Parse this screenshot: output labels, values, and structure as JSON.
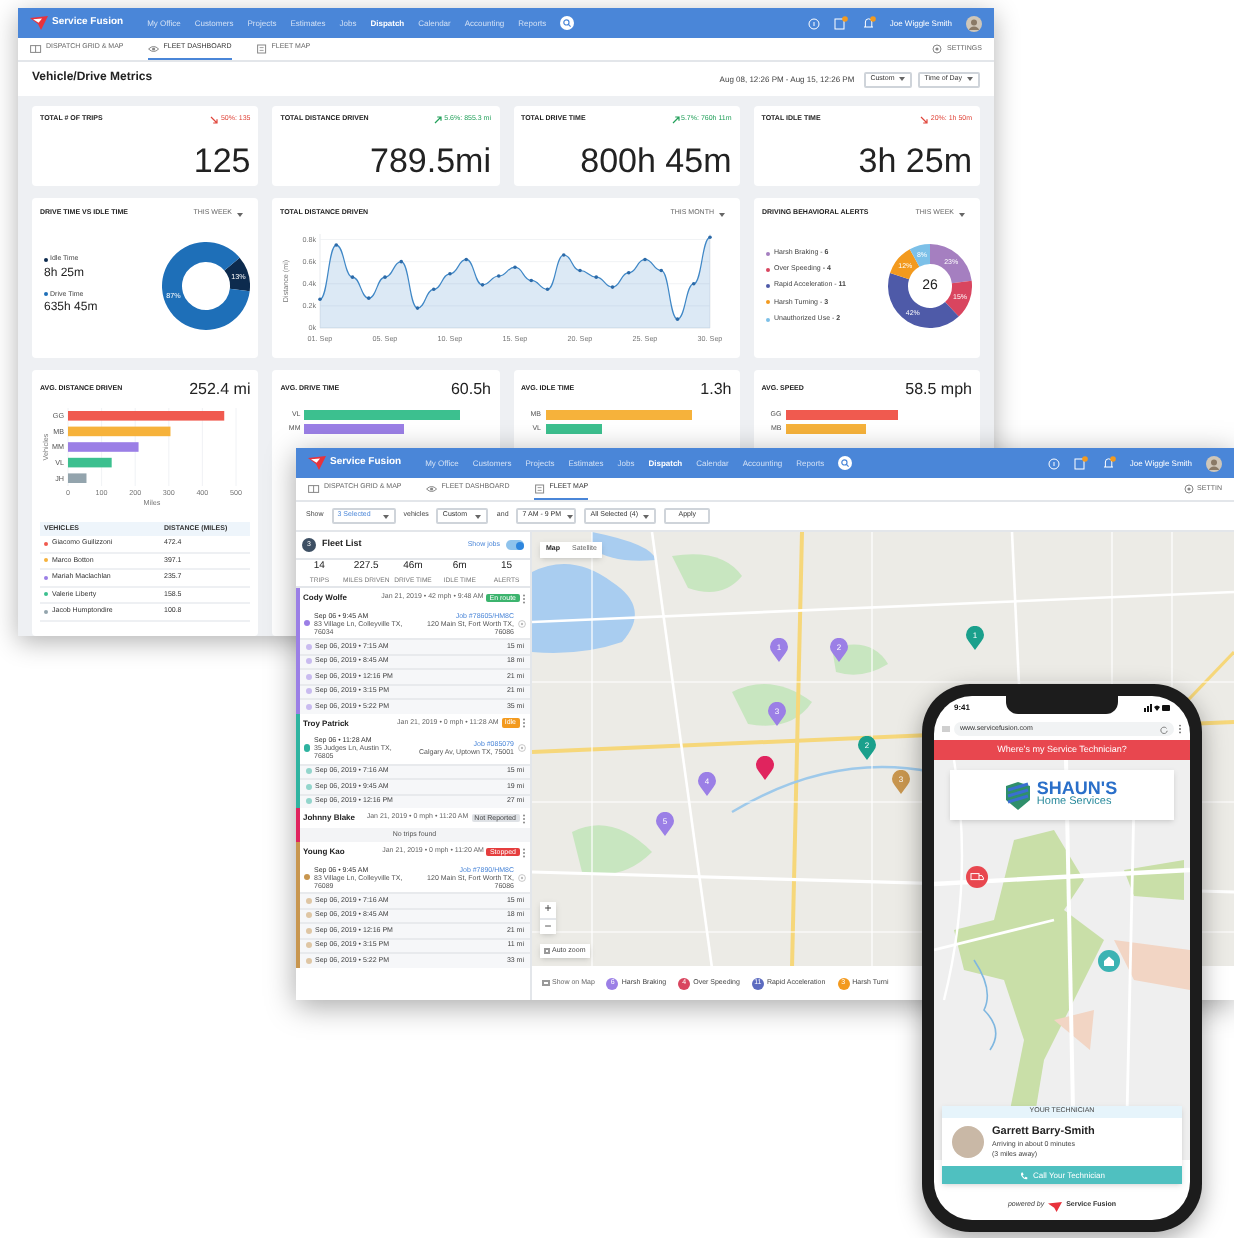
{
  "dashboard": {
    "nav": {
      "brand": "Service Fusion",
      "items": [
        {
          "label": "My Office",
          "selected": false
        },
        {
          "label": "Customers",
          "selected": false
        },
        {
          "label": "Projects",
          "selected": false
        },
        {
          "label": "Estimates",
          "selected": false
        },
        {
          "label": "Jobs",
          "selected": false
        },
        {
          "label": "Dispatch",
          "selected": true
        },
        {
          "label": "Calendar",
          "selected": false
        },
        {
          "label": "Accounting",
          "selected": false
        },
        {
          "label": "Reports",
          "selected": false
        }
      ],
      "user": "Joe Wiggle Smith"
    },
    "subnav": {
      "tabs": [
        {
          "label": "DISPATCH GRID & MAP",
          "selected": false
        },
        {
          "label": "FLEET DASHBOARD",
          "selected": true
        },
        {
          "label": "FLEET MAP",
          "selected": false
        }
      ],
      "settings": "SETTINGS"
    },
    "title": "Vehicle/Drive Metrics",
    "date_range": "Aug 08, 12:26 PM - Aug 15, 12:26 PM",
    "filters": [
      "Custom",
      "Time of Day"
    ],
    "stats": [
      {
        "label": "TOTAL # OF TRIPS",
        "change": "50%: 135",
        "increase": false,
        "value": "125"
      },
      {
        "label": "TOTAL DISTANCE DRIVEN",
        "change": "5.6%: 855.3 mi",
        "increase": true,
        "value": "789.5mi"
      },
      {
        "label": "TOTAL DRIVE TIME",
        "change": "5.7%: 760h 11m",
        "increase": true,
        "value": "800h 45m"
      },
      {
        "label": "TOTAL IDLE TIME",
        "change": "20%: 1h 50m",
        "increase": false,
        "value": "3h 25m"
      }
    ],
    "drive_vs_idle": {
      "title": "DRIVE TIME VS IDLE TIME",
      "period": "THIS WEEK",
      "legend": [
        {
          "value": "8h 25m",
          "color": "#0d2b4e"
        },
        {
          "value": "635h 45m",
          "color": "#1e6fb8"
        }
      ],
      "chart_data": {
        "type": "donut",
        "categories": [
          "Idle Time",
          "Drive Time"
        ],
        "values": [
          13,
          87
        ],
        "value_labels": [
          "13%",
          "87%"
        ]
      }
    },
    "distance": {
      "title": "TOTAL DISTANCE DRIVEN",
      "period": "THIS MONTH",
      "chart_data": {
        "type": "area",
        "ylabel": "Distance (mi)",
        "grid": true,
        "ylim": [
          0,
          0.85
        ],
        "categories": [
          "01. Sep",
          null,
          null,
          null,
          "05. Sep",
          null,
          null,
          null,
          "10. Sep",
          null,
          null,
          null,
          "15. Sep",
          null,
          null,
          null,
          "20. Sep",
          null,
          null,
          null,
          "25. Sep",
          null,
          null,
          null,
          "30. Sep"
        ],
        "yticks": [
          {
            "value": 0,
            "label": "0k"
          },
          {
            "value": 0.2,
            "label": "0.2k"
          },
          {
            "value": 0.4,
            "label": "0.4k"
          },
          {
            "value": 0.6,
            "label": "0.6k"
          },
          {
            "value": 0.8,
            "label": "0.8k"
          }
        ],
        "series": [
          {
            "color": "#3f87c6",
            "values": [
              0.26,
              0.75,
              0.46,
              0.27,
              0.46,
              0.6,
              0.18,
              0.35,
              0.49,
              0.62,
              0.39,
              0.47,
              0.55,
              0.43,
              0.35,
              0.66,
              0.52,
              0.46,
              0.37,
              0.5,
              0.62,
              0.52,
              0.08,
              0.4,
              0.82
            ]
          }
        ]
      }
    },
    "alerts": {
      "title": "DRIVING BEHAVIORAL ALERTS",
      "period": "THIS WEEK",
      "total": "26",
      "items": [
        {
          "text": "Harsh Braking - **6**",
          "color": "#a57fc0"
        },
        {
          "text": "Over Speeding - **4**",
          "color": "#d9455f"
        },
        {
          "text": "Rapid Acceleration - **11**",
          "color": "#4e5aa8"
        },
        {
          "text": "Harsh Turning - **3**",
          "color": "#f39a1e"
        },
        {
          "text": "Unauthorized Use - **2**",
          "color": "#7cc0e8"
        }
      ],
      "chart_data": {
        "type": "donut",
        "values": [
          23,
          15,
          42,
          12,
          8
        ],
        "value_labels": [
          "23%",
          "15%",
          "42%",
          "12%",
          "8%"
        ]
      }
    },
    "averages": [
      {
        "title": "AVG. DISTANCE DRIVEN",
        "value": "252.4 mi",
        "chart_data": {
          "type": "bar",
          "orientation": "horizontal",
          "grid": true,
          "xlabel": "Miles",
          "ylabel": "Vehicles",
          "categories": [
            "GG",
            "MB",
            "MM",
            "VL",
            "JH"
          ],
          "values": [
            465,
            305,
            210,
            130,
            55
          ],
          "xlim": [
            0,
            500
          ],
          "xticks": [
            0,
            100,
            200,
            300,
            400,
            500
          ]
        },
        "table": {
          "columns": [
            "VEHICLES",
            "DISTANCE (MILES)"
          ],
          "rows": [
            {
              "name": "Giacomo Guilizzoni",
              "value": "472.4",
              "color": "#f05a4f"
            },
            {
              "name": "Marco Botton",
              "value": "397.1",
              "color": "#f6b23b"
            },
            {
              "name": "Mariah Maclachlan",
              "value": "235.7",
              "color": "#9b7fe6"
            },
            {
              "name": "Valerie Liberty",
              "value": "158.5",
              "color": "#3cc08f"
            },
            {
              "name": "Jacob Humptondire",
              "value": "100.8",
              "color": "#93a4ad"
            }
          ]
        }
      },
      {
        "title": "AVG. DRIVE TIME",
        "value": "60.5h",
        "bar_labels": [
          "VL",
          "MM"
        ]
      },
      {
        "title": "AVG. IDLE TIME",
        "value": "1.3h",
        "bar_labels": [
          "MB",
          "VL"
        ]
      },
      {
        "title": "AVG. SPEED",
        "value": "58.5 mph",
        "bar_labels": [
          "GG",
          "MB"
        ]
      }
    ]
  },
  "fleet_map": {
    "nav": {
      "brand": "Service Fusion",
      "items": [
        {
          "label": "My Office",
          "selected": false
        },
        {
          "label": "Customers",
          "selected": false
        },
        {
          "label": "Projects",
          "selected": false
        },
        {
          "label": "Estimates",
          "selected": false
        },
        {
          "label": "Jobs",
          "selected": false
        },
        {
          "label": "Dispatch",
          "selected": true
        },
        {
          "label": "Calendar",
          "selected": false
        },
        {
          "label": "Accounting",
          "selected": false
        },
        {
          "label": "Reports",
          "selected": false
        }
      ],
      "user": "Joe Wiggle Smith"
    },
    "subnav": {
      "tabs": [
        {
          "label": "DISPATCH GRID & MAP",
          "selected": false
        },
        {
          "label": "FLEET DASHBOARD",
          "selected": false
        },
        {
          "label": "FLEET MAP",
          "selected": true
        }
      ],
      "settings": "SETTIN"
    },
    "filter_bar": {
      "show_label": "Show",
      "vehicles_select": "3 Selected",
      "vehicles_label": "vehicles",
      "range_select": "Custom",
      "and_label": "and",
      "time_select": "7 AM - 9 PM",
      "status_select": "All Selected (4)",
      "apply": "Apply"
    },
    "fleet_list": {
      "count": "3",
      "title": "Fleet List",
      "show_jobs": "Show jobs",
      "show_jobs_on": true,
      "stats": [
        {
          "value": "14",
          "label": "TRIPS"
        },
        {
          "value": "227.5",
          "label": "MILES DRIVEN"
        },
        {
          "value": "46m",
          "label": "DRIVE TIME"
        },
        {
          "value": "6m",
          "label": "IDLE TIME"
        },
        {
          "value": "15",
          "label": "ALERTS"
        }
      ],
      "drivers": [
        {
          "name": "Cody Wolfe",
          "info": "Jan 21, 2019 • 42 mph • 9:48 AM",
          "status": "En route",
          "kind": "en_route",
          "color": "#9b7fe6",
          "current": {
            "time": "Sep 06 • 9:45 AM",
            "address": "83 Village Ln, Colleyville TX, 76034",
            "job": "Job #78605/HM8C",
            "job_address": "120 Main St, Fort Worth TX, 76086"
          },
          "trips": [
            {
              "time": "Sep 06, 2019 • 7:15 AM",
              "distance": "15 mi"
            },
            {
              "time": "Sep 06, 2019 • 8:45 AM",
              "distance": "18 mi"
            },
            {
              "time": "Sep 06, 2019 • 12:16 PM",
              "distance": "21 mi"
            },
            {
              "time": "Sep 06, 2019 • 3:15 PM",
              "distance": "21 mi"
            },
            {
              "time": "Sep 06, 2019 • 5:22 PM",
              "distance": "35 mi"
            }
          ]
        },
        {
          "name": "Troy Patrick",
          "info": "Jan 21, 2019 • 0 mph • 11:28 AM",
          "status": "Idle",
          "kind": "idle",
          "color": "#2fb3a0",
          "current": {
            "time": "Sep 06 • 11:28 AM",
            "address": "35 Judges Ln, Austin TX, 76805",
            "job": "Job #085079",
            "job_address": "Calgary Av, Uptown TX, 75001"
          },
          "trips": [
            {
              "time": "Sep 06, 2019 • 7:16 AM",
              "distance": "15 mi"
            },
            {
              "time": "Sep 06, 2019 • 9:45 AM",
              "distance": "19 mi"
            },
            {
              "time": "Sep 06, 2019 • 12:16 PM",
              "distance": "27 mi"
            }
          ]
        },
        {
          "name": "Johnny Blake",
          "info": "Jan 21, 2019 • 0 mph • 11:20 AM",
          "status": "Not Reported",
          "kind": "not_reported",
          "color": "#e0245e",
          "no_trips": "No trips found"
        },
        {
          "name": "Young Kao",
          "info": "Jan 21, 2019 • 0 mph • 11:20 AM",
          "status": "Stopped",
          "kind": "stopped",
          "color": "#c8964f",
          "current": {
            "time": "Sep 06 • 9:45 AM",
            "address": "83 Village Ln, Colleyville TX, 76089",
            "job": "Job #7890/HM8C",
            "job_address": "120 Main St, Fort Worth TX, 76086"
          },
          "trips": [
            {
              "time": "Sep 06, 2019 • 7:16 AM",
              "distance": "15 mi"
            },
            {
              "time": "Sep 06, 2019 • 8:45 AM",
              "distance": "18 mi"
            },
            {
              "time": "Sep 06, 2019 • 12:16 PM",
              "distance": "21 mi"
            },
            {
              "time": "Sep 06, 2019 • 3:15 PM",
              "distance": "11 mi"
            },
            {
              "time": "Sep 06, 2019 • 5:22 PM",
              "distance": "33 mi"
            }
          ]
        }
      ]
    },
    "map": {
      "tabs": [
        {
          "label": "Map",
          "selected": true
        },
        {
          "label": "Satellite",
          "selected": false
        }
      ],
      "zoom_in": "+",
      "zoom_out": "−",
      "auto_zoom": "Auto zoom",
      "auto_zoom_checked": false,
      "pins": [
        {
          "label": "1",
          "color": "#1aa08c"
        },
        {
          "label": "1",
          "color": "#9b7fe6"
        },
        {
          "label": "2",
          "color": "#9b7fe6"
        },
        {
          "label": "3",
          "color": "#9b7fe6"
        },
        {
          "label": "2",
          "color": "#1aa08c"
        },
        {
          "color": "#e0245e"
        },
        {
          "label": "4",
          "color": "#9b7fe6"
        },
        {
          "label": "5",
          "color": "#9b7fe6"
        },
        {
          "label": "3",
          "color": "#c8964f"
        }
      ],
      "legend": {
        "show_on_map": "Show on Map",
        "show_on_map_checked": false,
        "items": [
          {
            "count": "6",
            "label": "Harsh Braking",
            "color": "#9b7fe6"
          },
          {
            "count": "4",
            "label": "Over Speeding",
            "color": "#d9455f"
          },
          {
            "count": "11",
            "label": "Rapid Acceleration",
            "color": "#5c6bc0"
          },
          {
            "count": "3",
            "label": "Harsh Turni",
            "color": "#f39a1e"
          }
        ]
      }
    }
  },
  "phone": {
    "time": "9:41",
    "url": "www.servicefusion.com",
    "banner": "Where's my Service Technician?",
    "logo_title": "SHAUN'S",
    "logo_subtitle": "Home Services",
    "technician_header": "YOUR TECHNICIAN",
    "technician_name": "Garrett Barry-Smith",
    "arrival": "Arriving in about 0 minutes",
    "distance": "(3 miles away)",
    "call_button": "Call Your Technician",
    "powered_by": "powered by",
    "powered_brand": "Service Fusion"
  }
}
